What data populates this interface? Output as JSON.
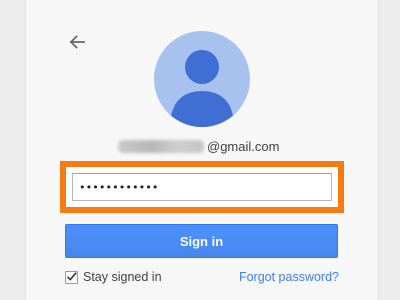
{
  "signin": {
    "back_icon": "arrow-left-icon",
    "avatar_icon": "user-silhouette-icon",
    "email_suffix": "@gmail.com",
    "password_masked": "••••••••••••",
    "signin_label": "Sign in",
    "stay_signed_in_label": "Stay signed in",
    "stay_signed_in_checked": true,
    "forgot_label": "Forgot password?"
  },
  "colors": {
    "highlight": "#f57c15",
    "button": "#4d90fe",
    "link": "#427fed",
    "avatar_bg": "#a7c2ee",
    "avatar_fg": "#3f6fd3"
  }
}
